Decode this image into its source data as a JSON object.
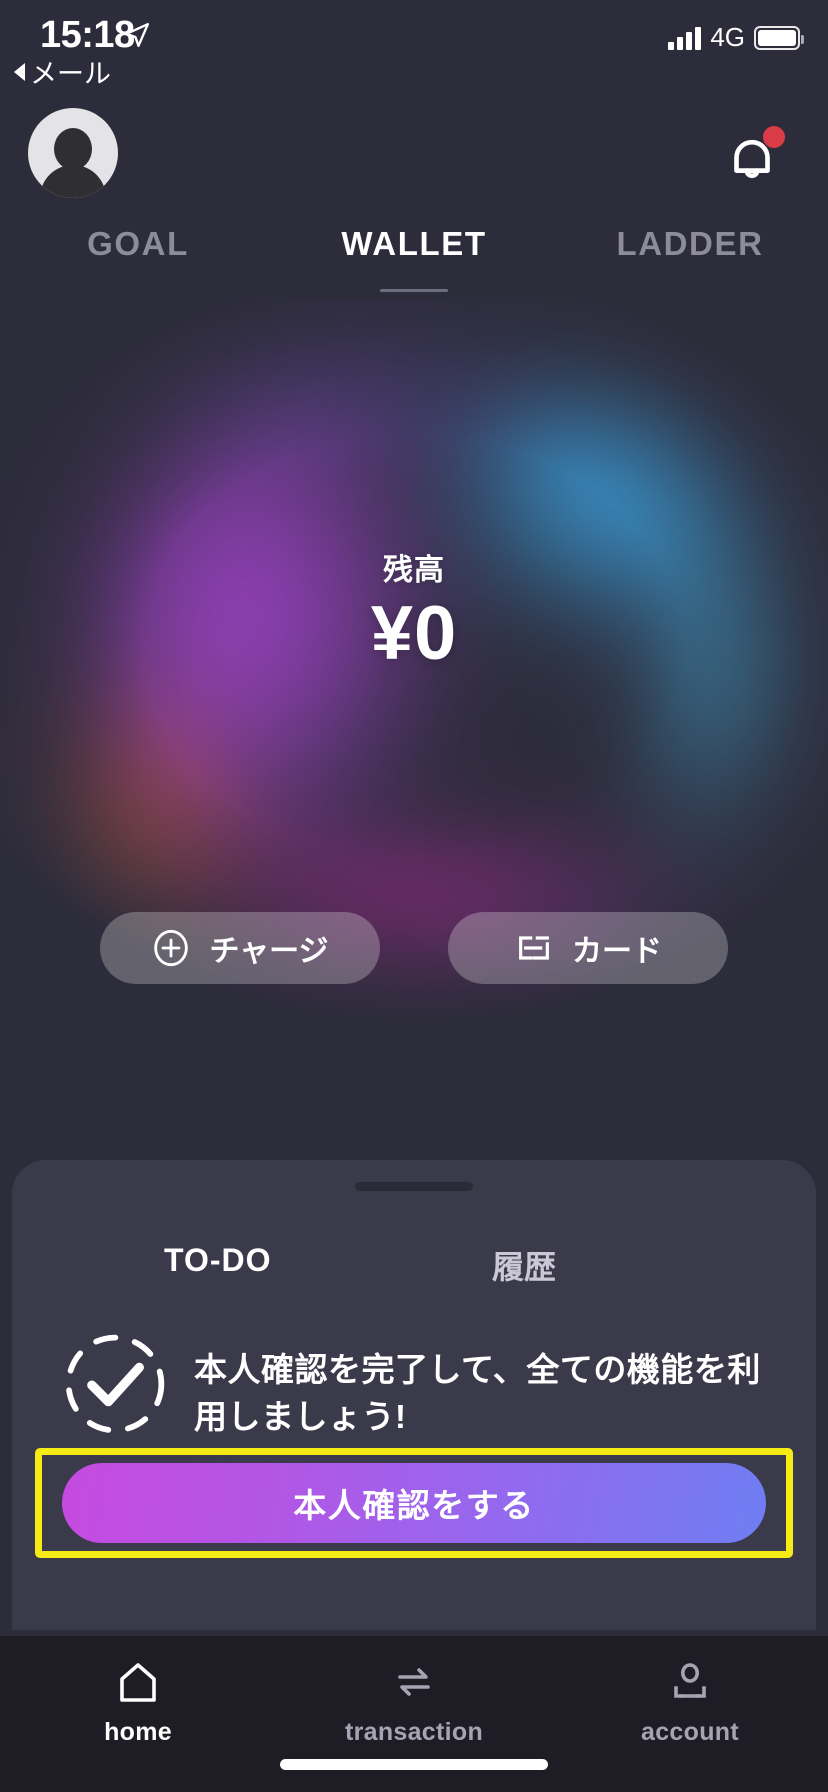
{
  "status_bar": {
    "time": "15:18",
    "back_label": "メール",
    "network": "4G",
    "location_icon": "location-arrow-icon",
    "signal_icon": "signal-bars-icon",
    "battery_icon": "battery-icon"
  },
  "header": {
    "avatar_icon": "user-avatar-icon",
    "bell_icon": "notification-bell-icon",
    "has_unread_badge": true
  },
  "top_tabs": [
    {
      "label": "GOAL",
      "active": false
    },
    {
      "label": "WALLET",
      "active": true
    },
    {
      "label": "LADDER",
      "active": false
    }
  ],
  "wallet": {
    "balance_label": "残高",
    "balance_amount": "¥0",
    "actions": [
      {
        "label": "チャージ",
        "icon": "plus-circle-icon"
      },
      {
        "label": "カード",
        "icon": "card-icon"
      }
    ]
  },
  "sheet": {
    "tabs": [
      {
        "label": "TO-DO",
        "active": true
      },
      {
        "label": "履歴",
        "active": false
      }
    ],
    "todo": {
      "icon": "dashed-check-circle-icon",
      "message": "本人確認を完了して、全ての機能を利用しましょう!",
      "cta_label": "本人確認をする"
    }
  },
  "bottom_nav": [
    {
      "label": "home",
      "icon": "home-icon",
      "active": true
    },
    {
      "label": "transaction",
      "icon": "transfer-arrows-icon",
      "active": false
    },
    {
      "label": "account",
      "icon": "person-card-icon",
      "active": false
    }
  ],
  "colors": {
    "background": "#2d2c3b",
    "sheet": "#3b3a4b",
    "nav_bar": "#1e1d26",
    "highlight": "#f6eb14",
    "badge": "#d93b47",
    "cta_gradient_start": "#c64ae0",
    "cta_gradient_end": "#6f7ef2"
  }
}
